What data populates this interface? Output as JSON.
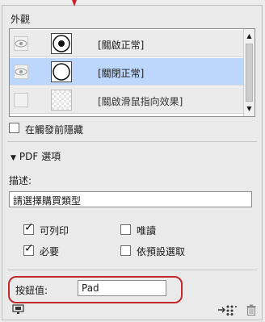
{
  "section": {
    "title": "外觀"
  },
  "states": [
    {
      "label": "[關啟正常]",
      "visible": true,
      "selected": false
    },
    {
      "label": "[關閉正常]",
      "visible": true,
      "selected": true
    },
    {
      "label": "[關啟滑鼠指向效果]",
      "visible": false,
      "selected": false
    }
  ],
  "hide_until_triggered": {
    "label": "在觸發前隱藏",
    "checked": false
  },
  "pdf_options": {
    "title": "PDF 選項",
    "description_label": "描述:",
    "description_value": "請選擇購買類型",
    "printable": {
      "label": "可列印",
      "checked": true
    },
    "required": {
      "label": "必要",
      "checked": true
    },
    "read_only": {
      "label": "唯讀",
      "checked": false
    },
    "selected_by_default": {
      "label": "依預設選取",
      "checked": false
    }
  },
  "button_value": {
    "label": "按鈕值:",
    "value": "Pad"
  },
  "colors": {
    "accent": "#c02a2a",
    "selection": "#bcd7fb",
    "panel": "#eaeaea"
  },
  "icons": [
    "eye-icon",
    "preview-icon",
    "convert-icon",
    "trash-icon"
  ]
}
